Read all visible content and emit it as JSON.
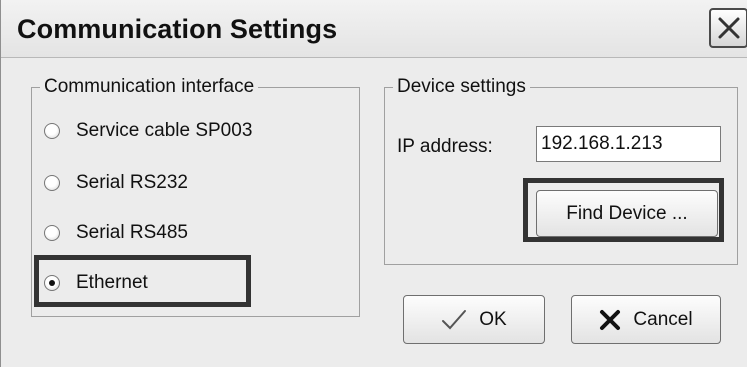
{
  "window": {
    "title": "Communication Settings"
  },
  "interface_group": {
    "legend": "Communication interface",
    "options": [
      {
        "label": "Service cable SP003",
        "checked": false
      },
      {
        "label": "Serial RS232",
        "checked": false
      },
      {
        "label": "Serial RS485",
        "checked": false
      },
      {
        "label": "Ethernet",
        "checked": true
      }
    ]
  },
  "device_group": {
    "legend": "Device settings",
    "ip_label": "IP address:",
    "ip_value": "192.168.1.213",
    "find_button": "Find Device ..."
  },
  "buttons": {
    "ok": "OK",
    "cancel": "Cancel"
  },
  "icons": {
    "close": "close-x-icon",
    "ok": "checkmark-icon",
    "cancel": "cross-icon"
  },
  "colors": {
    "highlight": "#333333",
    "window_bg": "#ececec"
  }
}
